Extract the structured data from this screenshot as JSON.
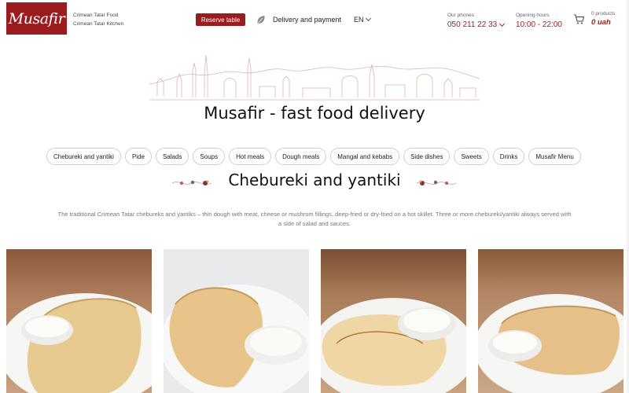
{
  "header": {
    "logo_text": "Musafir",
    "tagline_line1": "Crimean Tatar Food",
    "tagline_line2": "Crimean Tatar Kitchen",
    "reserve_label": "Reserve table",
    "delivery_label": "Delivery and payment",
    "language": "EN",
    "phones_label": "Our phones",
    "phone": "050 211 22 33",
    "hours_label": "Opening hours",
    "hours": "10:00 - 22:00",
    "cart_count": "0 products",
    "cart_total": "0 uah"
  },
  "hero": {
    "title": "Musafir - fast food delivery"
  },
  "categories": [
    "Chebureki and yantiki",
    "Pide",
    "Salads",
    "Soups",
    "Hot meals",
    "Dough meals",
    "Mangal and kebabs",
    "Side dishes",
    "Sweets",
    "Drinks",
    "Musafir Menu"
  ],
  "section": {
    "title": "Chebureki and yantiki",
    "description_line1": "The traditional Crimean Tatar chebureks and yantiks – thin dough with meat, cheese or mushrom fillings, deep-fried or dry-fried on a hot skillet. Three or more chebureki/yantiki always served with",
    "description_line2": "a side of salad and sauces."
  },
  "colors": {
    "brand": "#9b1c1f",
    "text": "#222222",
    "muted": "#777777"
  }
}
